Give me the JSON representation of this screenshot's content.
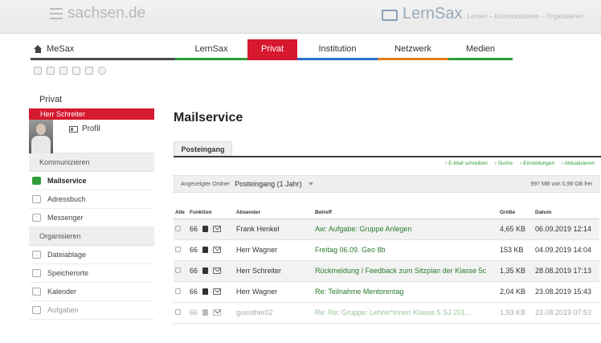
{
  "header": {
    "left_logo": "sachsen.de",
    "right_logo": "LernSax",
    "tagline": "Lernen – Kommunizieren – Organisieren"
  },
  "mainnav": {
    "home": "MeSax",
    "tabs": [
      "LernSax",
      "Privat",
      "Institution",
      "Netzwerk",
      "Medien"
    ],
    "active": "Privat"
  },
  "sidebar": {
    "title": "Privat",
    "user": "Herr Schreiter",
    "profile_label": "Profil",
    "sections": [
      {
        "label": "Kommunizieren",
        "items": [
          {
            "label": "Mailservice",
            "icon": "mail-icon",
            "active": true
          },
          {
            "label": "Adressbuch",
            "icon": "addressbook-icon"
          },
          {
            "label": "Messenger",
            "icon": "messenger-icon"
          }
        ]
      },
      {
        "label": "Organisieren",
        "items": [
          {
            "label": "Dateiablage",
            "icon": "folder-icon"
          },
          {
            "label": "Speicherorte",
            "icon": "storage-icon"
          },
          {
            "label": "Kalender",
            "icon": "calendar-icon"
          },
          {
            "label": "Aufgaben",
            "icon": "tasks-icon"
          }
        ]
      }
    ]
  },
  "main": {
    "title": "Mailservice",
    "tab": "Posteingang",
    "actions": [
      "E-Mail schreiben",
      "Suche",
      "Einstellungen",
      "Aktualisieren"
    ],
    "folder_label": "Angezeigter Ordner",
    "folder_value": "Posteingang  (1 Jahr)",
    "quota": "997 MB von 0,98 GB frei",
    "columns": {
      "all": "Alle",
      "function": "Funktion",
      "sender": "Absender",
      "subject": "Betreff",
      "size": "Größe",
      "date": "Datum"
    },
    "rows": [
      {
        "sender": "Frank Henkel",
        "subject": "Aw: Aufgabe: Gruppe Anlegen",
        "size": "4,65 KB",
        "date": "06.09.2019 12:14"
      },
      {
        "sender": "Herr Wagner",
        "subject": "Freitag 06.09. Geo 8b",
        "size": "153 KB",
        "date": "04.09.2019 14:04"
      },
      {
        "sender": "Herr Schreiter",
        "subject": "Rückmeldung / Feedback zum Sitzplan der Klasse 5c",
        "size": "1,35 KB",
        "date": "28.08.2019 17:13"
      },
      {
        "sender": "Herr Wagner",
        "subject": "Re: Teilnahme Mentorentag",
        "size": "2,04 KB",
        "date": "23.08.2019 15:43"
      },
      {
        "sender": "guenther02",
        "subject": "Re: Re: Gruppe: Lehrer*innen Klasse 5 SJ 201...",
        "size": "1,93 KB",
        "date": "23.08.2019 07:53"
      }
    ]
  }
}
